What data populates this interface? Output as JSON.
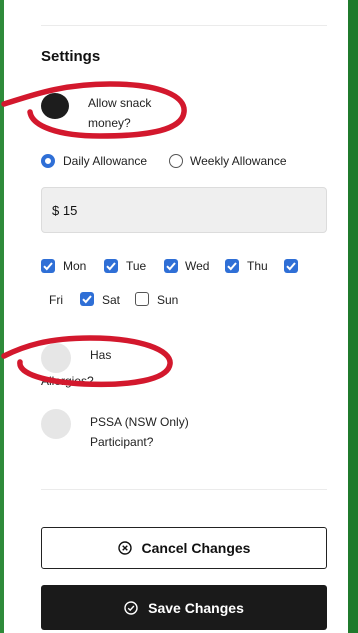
{
  "settings": {
    "title": "Settings",
    "snack_money": {
      "label_line1": "Allow snack",
      "label_line2": "money?",
      "checked": true
    },
    "allowance": {
      "options": [
        "Daily Allowance",
        "Weekly Allowance"
      ],
      "selected": "Daily Allowance"
    },
    "amount": {
      "value": "$ 15"
    },
    "days": [
      {
        "label": "Mon",
        "checked": true
      },
      {
        "label": "Tue",
        "checked": true
      },
      {
        "label": "Wed",
        "checked": true
      },
      {
        "label": "Thu",
        "checked": true
      },
      {
        "label": "Fri",
        "checked": true
      },
      {
        "label": "Sat",
        "checked": true
      },
      {
        "label": "Sun",
        "checked": false
      }
    ],
    "allergies": {
      "label_line1": "Has",
      "label_line2": "Allergies?",
      "checked": false
    },
    "pssa": {
      "label_line1": "PSSA (NSW Only)",
      "label_line2": "Participant?",
      "checked": false
    }
  },
  "actions": {
    "cancel_label": "Cancel Changes",
    "save_label": "Save Changes"
  },
  "colors": {
    "accent": "#2f6fd6",
    "annotation": "#d3182d",
    "frame": "#2e8b3a",
    "save_button": "#1a1a1a"
  }
}
